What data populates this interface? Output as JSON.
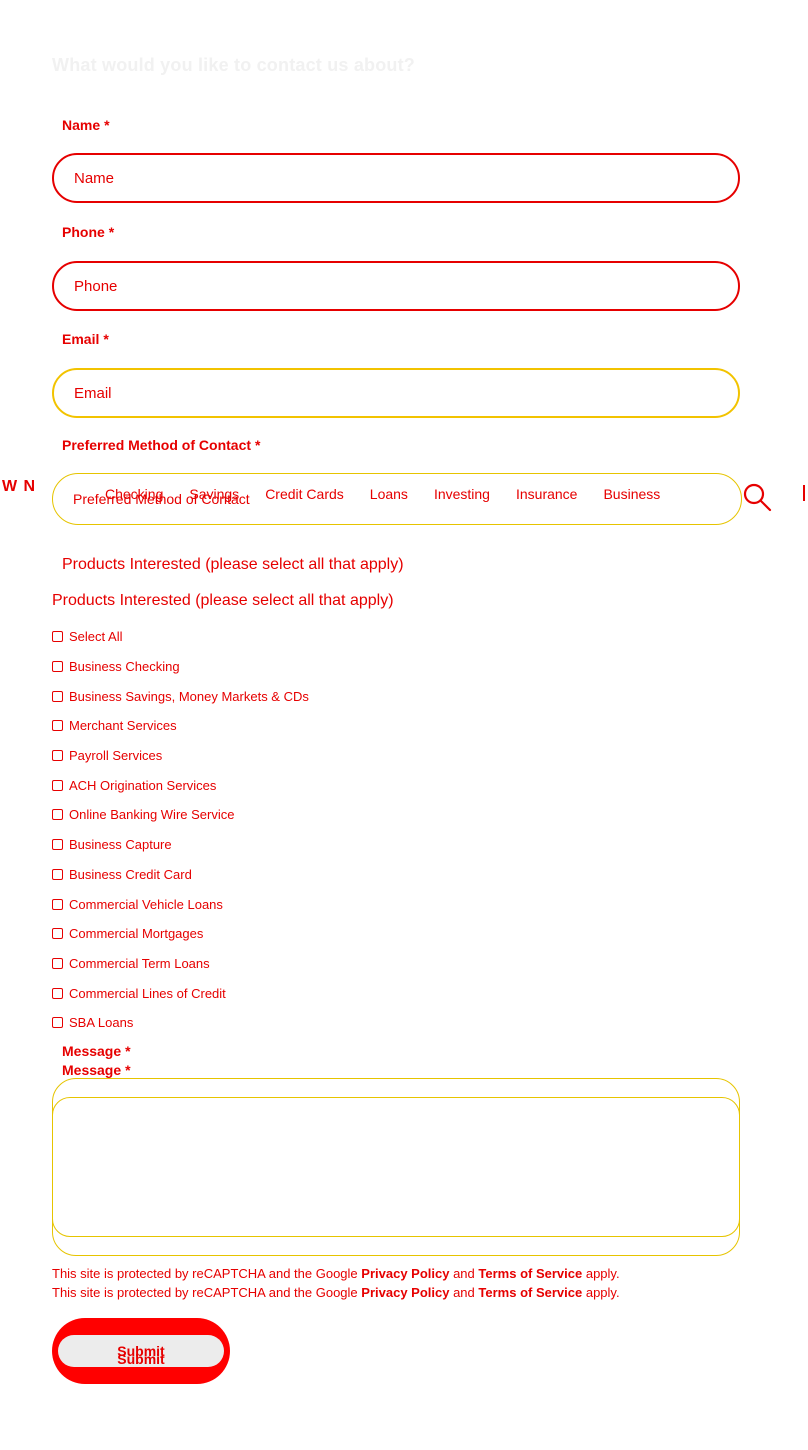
{
  "form": {
    "heading": "What would you like to contact us about?",
    "required_marker": "*",
    "name": {
      "label": "Name",
      "placeholder": "Name"
    },
    "phone": {
      "label": "Phone",
      "placeholder": "Phone"
    },
    "email": {
      "label": "Email",
      "placeholder": "Email"
    },
    "contact_method": {
      "label": "Preferred Method of Contact",
      "placeholder": "Preferred Method of Contact"
    },
    "products": {
      "label": "Products Interested (please select all that apply)",
      "legend": "Products Interested (please select all that apply)",
      "options": [
        "Select All",
        "Business Checking",
        "Business Savings, Money Markets & CDs",
        "Merchant Services",
        "Payroll Services",
        "ACH Origination Services",
        "Online Banking Wire Service",
        "Business Capture",
        "Business Credit Card",
        "Commercial Vehicle Loans",
        "Commercial Mortgages",
        "Commercial Term Loans",
        "Commercial Lines of Credit",
        "SBA Loans"
      ]
    },
    "message": {
      "label": "Message"
    },
    "recaptcha": {
      "prefix": "This site is protected by reCAPTCHA and the Google",
      "privacy": "Privacy Policy",
      "and": "and",
      "terms": "Terms of Service",
      "suffix": "apply."
    },
    "submit_label": "Submit"
  },
  "nav": {
    "brand_fragment": "W N",
    "items": [
      "Checking",
      "Savings",
      "Credit Cards",
      "Loans",
      "Investing",
      "Insurance",
      "Business"
    ]
  },
  "icons": {
    "search": "search-icon"
  },
  "colors": {
    "accent": "#e60000",
    "submit": "#ff0000",
    "outline_alt": "#e6c400"
  }
}
